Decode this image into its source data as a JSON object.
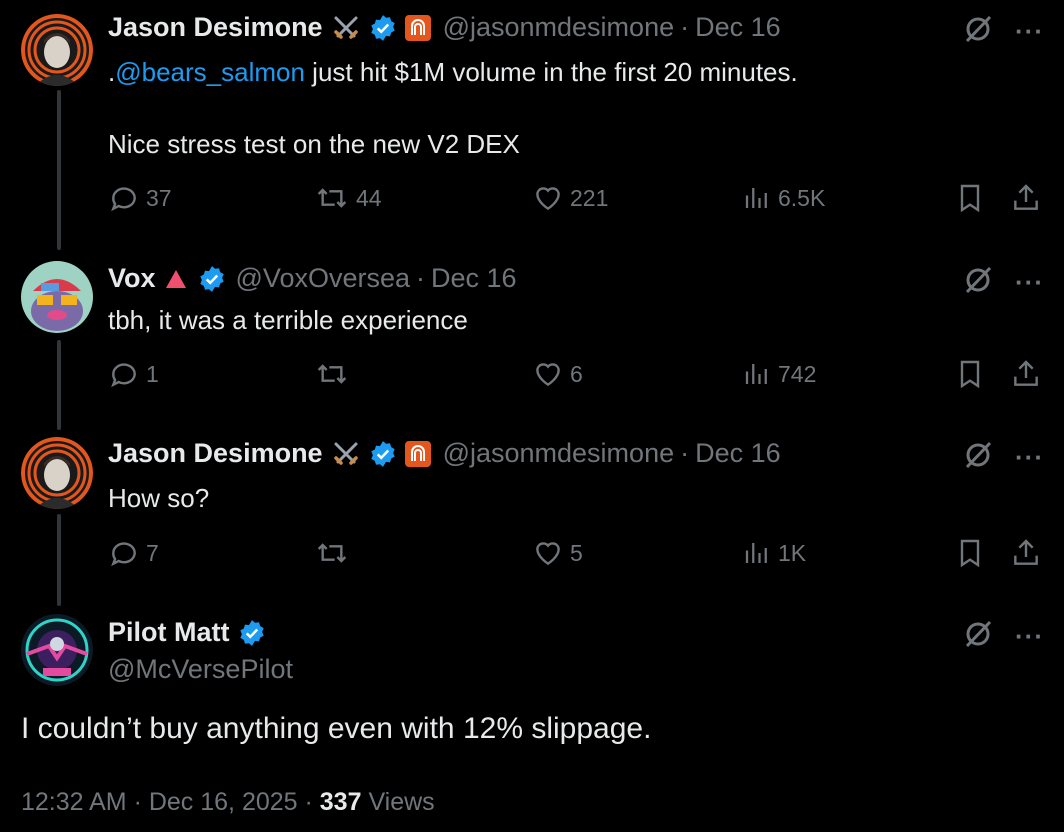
{
  "tweets": [
    {
      "name": "Jason Desimone",
      "handle": "@jasonmdesimone",
      "date": "Dec 16",
      "text_prefix": ".",
      "mention": "@bears_salmon",
      "text_rest": " just hit $1M volume in the first 20 minutes.\n\nNice stress test on the new V2 DEX",
      "replies": "37",
      "reposts": "44",
      "likes": "221",
      "views": "6.5K"
    },
    {
      "name": "Vox",
      "handle": "@VoxOversea",
      "date": "Dec 16",
      "text": "tbh, it was a terrible experience",
      "replies": "1",
      "reposts": "",
      "likes": "6",
      "views": "742"
    },
    {
      "name": "Jason Desimone",
      "handle": "@jasonmdesimone",
      "date": "Dec 16",
      "text": "How so?",
      "replies": "7",
      "reposts": "",
      "likes": "5",
      "views": "1K"
    }
  ],
  "main": {
    "name": "Pilot Matt",
    "handle": "@McVersePilot",
    "text": "I couldn’t buy anything even with 12% slippage.",
    "time": "12:32 AM · Dec 16, 2025 · ",
    "views_count": "337",
    "views_label": " Views"
  },
  "separator": "·",
  "more_label": "···",
  "colors": {
    "accent": "#1d9bf0",
    "muted": "#71767b",
    "background": "#000000",
    "verified": "#1d9bf0"
  }
}
